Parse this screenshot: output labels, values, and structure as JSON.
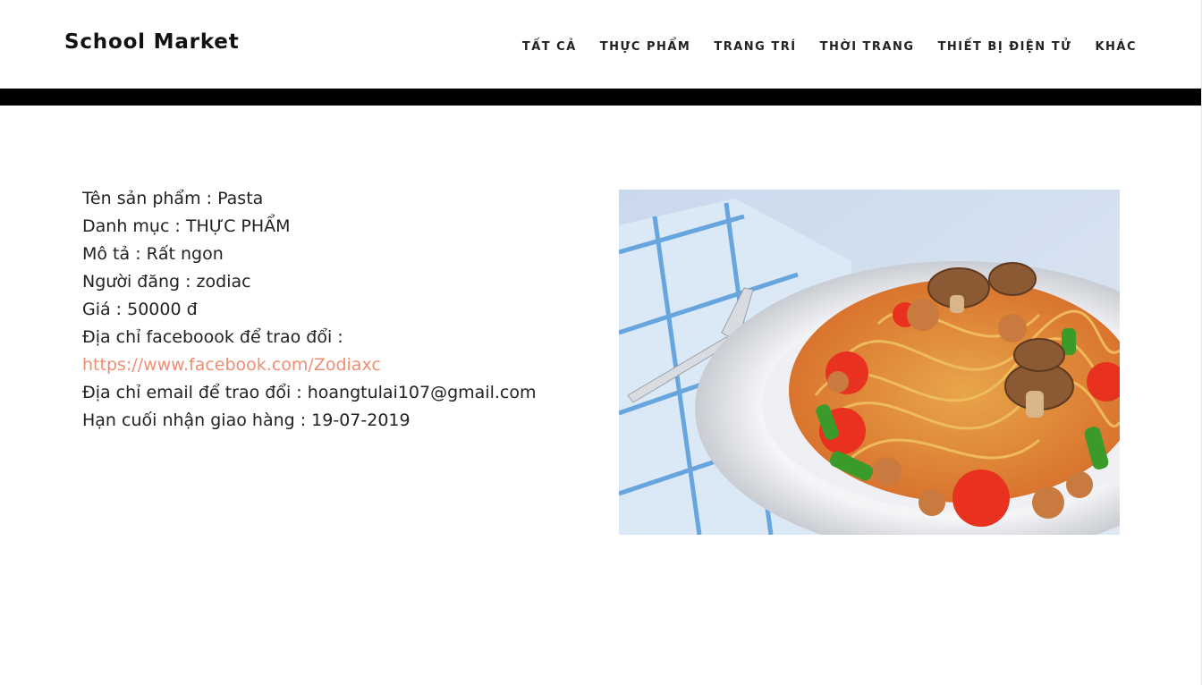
{
  "header": {
    "brand": "School Market",
    "nav": [
      "TẤT CẢ",
      "THỰC PHẨM",
      "TRANG TRÍ",
      "THỜI TRANG",
      "THIẾT BỊ ĐIỆN TỬ",
      "KHÁC"
    ]
  },
  "product": {
    "name_line": "Tên sản phẩm : Pasta",
    "category_line": "Danh mục : THỰC PHẨM",
    "description_line": "Mô tả : Rất ngon",
    "poster_line": "Người đăng : zodiac",
    "price_line": "Giá : 50000 đ",
    "facebook_label": "Địa chỉ faceboook để trao đổi :",
    "facebook_url": "https://www.facebook.com/Zodiaxc",
    "email_line": "Địa chỉ email để trao đổi : hoangtulai107@gmail.com",
    "deadline_line": "Hạn cuối nhận giao hàng : 19-07-2019",
    "image_icon": "pasta-photo"
  },
  "colors": {
    "link": "#ee8f74",
    "band": "#000000",
    "text": "#222222"
  }
}
